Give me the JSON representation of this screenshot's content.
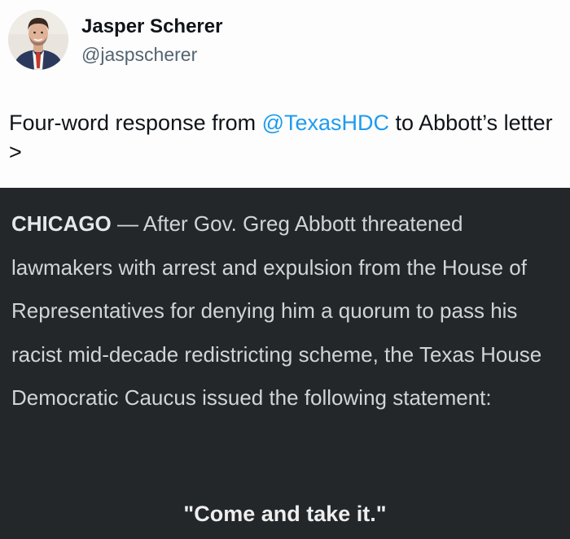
{
  "author": {
    "name": "Jasper Scherer",
    "handle": "@jaspscherer",
    "avatar_icon": "profile-photo-avatar"
  },
  "tweet": {
    "text_before": "Four-word response from ",
    "mention": "@TexasHDC",
    "text_after": " to Abbott’s letter >"
  },
  "statement": {
    "dateline": "CHICAGO",
    "separator": " — ",
    "body": "After Gov. Greg Abbott threatened lawmakers with arrest and expulsion from the House of Representatives for denying him a quorum to pass his racist mid-decade redistricting scheme, the Texas House Democratic Caucus issued the following statement:",
    "quote": "\"Come and take it.\""
  },
  "colors": {
    "link": "#1d9bf0",
    "statement_background": "#23272a"
  }
}
